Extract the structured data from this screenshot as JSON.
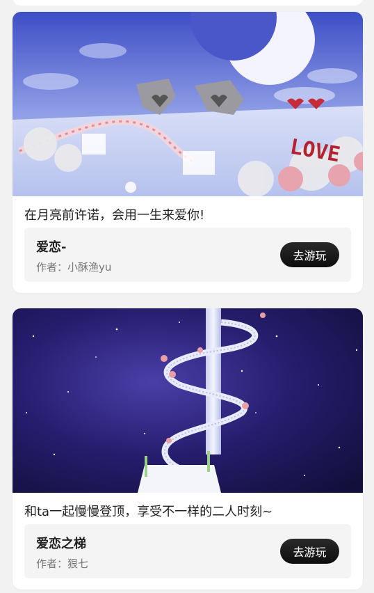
{
  "cards": [
    {
      "caption": "在月亮前许诺，会用一生来爱你!",
      "title": "爱恋-",
      "author": "作者：小酥渔yu",
      "button_label": "去游玩",
      "cover_text": "LOVE"
    },
    {
      "caption": "和ta一起慢慢登顶，享受不一样的二人时刻~",
      "title": "爱恋之梯",
      "author": "作者：狠七",
      "button_label": "去游玩"
    }
  ]
}
